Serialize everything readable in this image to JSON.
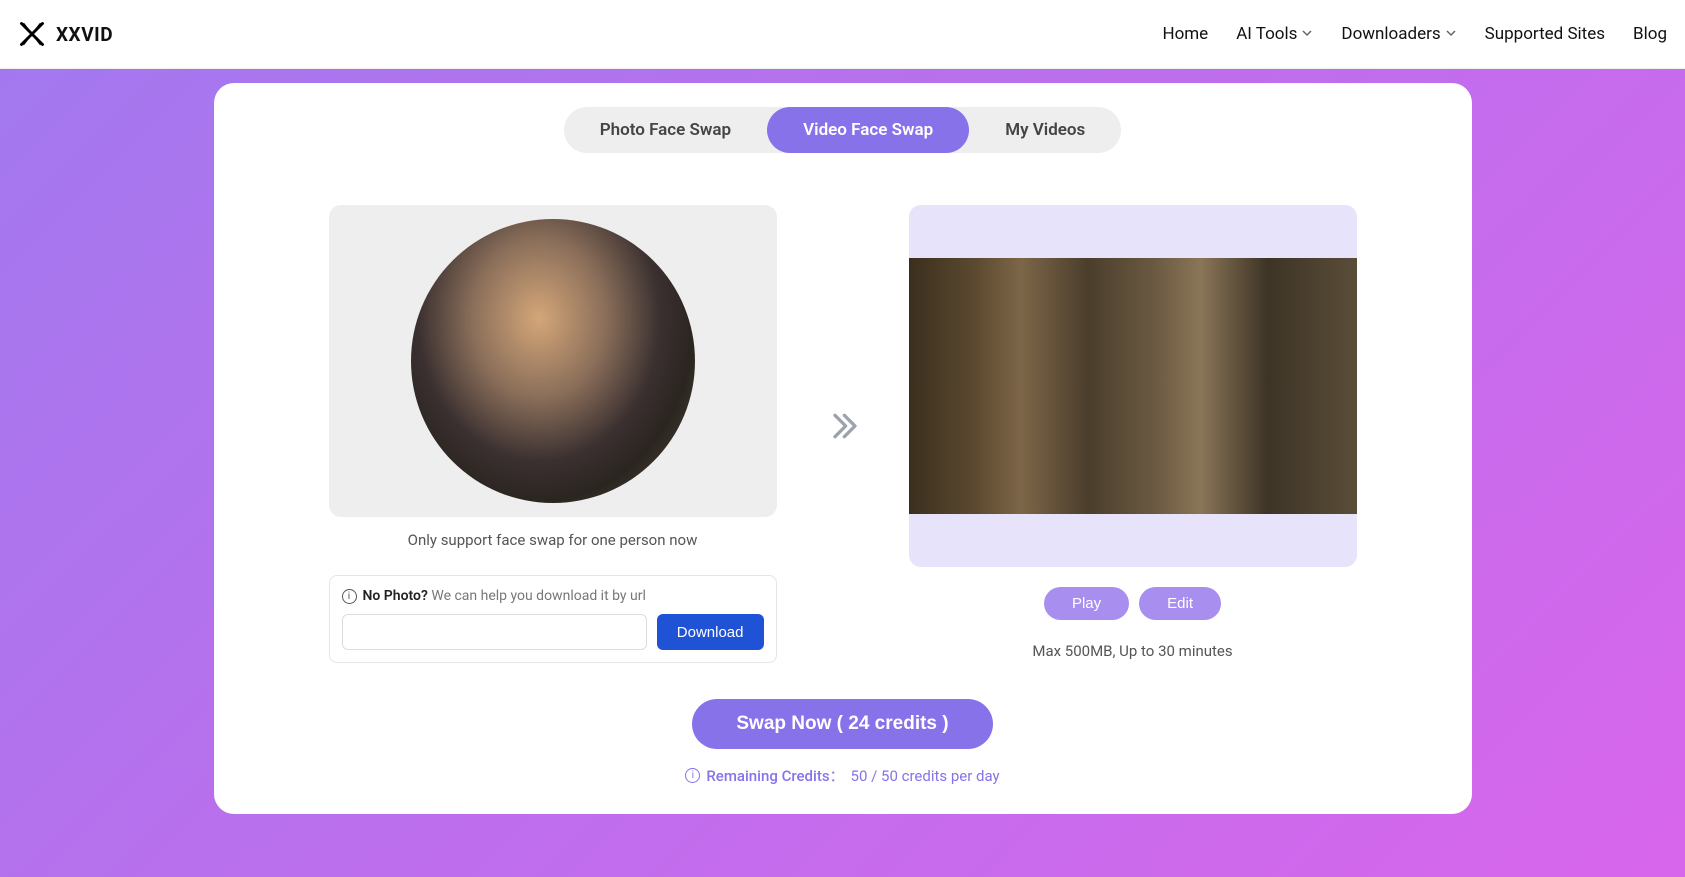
{
  "brand": "XXVID",
  "nav": {
    "home": "Home",
    "aiTools": "AI Tools",
    "downloaders": "Downloaders",
    "supportedSites": "Supported Sites",
    "blog": "Blog"
  },
  "tabs": {
    "photo": "Photo Face Swap",
    "video": "Video Face Swap",
    "myVideos": "My Videos"
  },
  "source": {
    "hint": "Only support face swap for one person now",
    "noPhotoLabel": "No Photo?",
    "noPhotoHelp": "We can help you download it by url",
    "downloadLabel": "Download"
  },
  "target": {
    "playLabel": "Play",
    "editLabel": "Edit",
    "hint": "Max 500MB, Up to 30 minutes"
  },
  "swap": {
    "label": "Swap Now ( 24 credits )"
  },
  "credits": {
    "label": "Remaining Credits：",
    "value": "50 / 50 credits per day"
  }
}
